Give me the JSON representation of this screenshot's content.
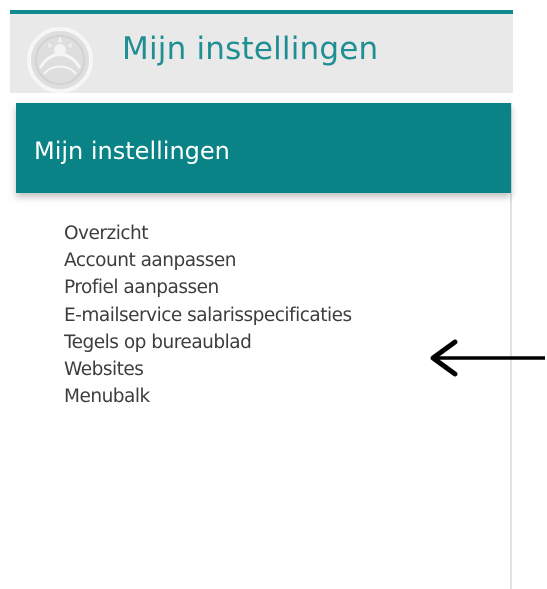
{
  "header": {
    "title": "Mijn instellingen",
    "logo_icon": "emblem-logo-icon",
    "accent_color": "#0f8a8f",
    "background_color": "#e9e9e9"
  },
  "panel": {
    "title": "Mijn instellingen",
    "header_color": "#0a8387"
  },
  "menu": {
    "items": [
      {
        "label": "Overzicht"
      },
      {
        "label": "Account aanpassen"
      },
      {
        "label": "Profiel aanpassen"
      },
      {
        "label": "E-mailservice salarisspecificaties"
      },
      {
        "label": "Tegels op bureaublad"
      },
      {
        "label": "Websites"
      },
      {
        "label": "Menubalk"
      }
    ]
  },
  "annotation": {
    "icon": "arrow-left-icon",
    "points_to_item": "E-mailservice salarisspecificaties"
  }
}
